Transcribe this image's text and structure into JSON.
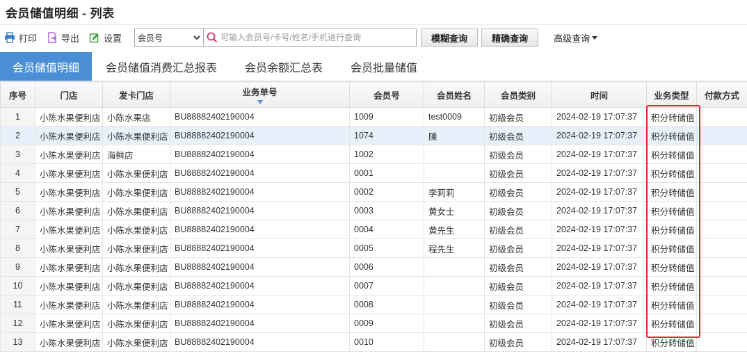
{
  "title": "会员储值明细 - 列表",
  "toolbar": {
    "print_label": "打印",
    "export_label": "导出",
    "settings_label": "设置",
    "search_field_value": "会员号",
    "search_placeholder": "可输入会员号/卡号/姓名/手机进行查询",
    "fuzzy_label": "模糊查询",
    "exact_label": "精确查询",
    "advanced_label": "高级查询"
  },
  "tabs": [
    {
      "label": "会员储值明细",
      "active": true
    },
    {
      "label": "会员储值消费汇总报表",
      "active": false
    },
    {
      "label": "会员余额汇总表",
      "active": false
    },
    {
      "label": "会员批量储值",
      "active": false
    }
  ],
  "table": {
    "headers": [
      "序号",
      "门店",
      "发卡门店",
      "业务单号",
      "会员号",
      "会员姓名",
      "会员类别",
      "时间",
      "业务类型",
      "付款方式"
    ],
    "rows": [
      [
        "1",
        "小陈水果便利店",
        "小陈水果店",
        "BU88882402190004",
        "1009",
        "test0009",
        "初级会员",
        "2024-02-19 17:07:37",
        "积分转储值",
        ""
      ],
      [
        "2",
        "小陈水果便利店",
        "小陈水果便利店",
        "BU88882402190004",
        "1074",
        "陳",
        "初级会员",
        "2024-02-19 17:07:37",
        "积分转储值",
        ""
      ],
      [
        "3",
        "小陈水果便利店",
        "海鲜店",
        "BU88882402190004",
        "1002",
        "",
        "初级会员",
        "2024-02-19 17:07:37",
        "积分转储值",
        ""
      ],
      [
        "4",
        "小陈水果便利店",
        "小陈水果便利店",
        "BU88882402190004",
        "0001",
        "",
        "初级会员",
        "2024-02-19 17:07:37",
        "积分转储值",
        ""
      ],
      [
        "5",
        "小陈水果便利店",
        "小陈水果便利店",
        "BU88882402190004",
        "0002",
        "李莉莉",
        "初级会员",
        "2024-02-19 17:07:37",
        "积分转储值",
        ""
      ],
      [
        "6",
        "小陈水果便利店",
        "小陈水果便利店",
        "BU88882402190004",
        "0003",
        "黄女士",
        "初级会员",
        "2024-02-19 17:07:37",
        "积分转储值",
        ""
      ],
      [
        "7",
        "小陈水果便利店",
        "小陈水果便利店",
        "BU88882402190004",
        "0004",
        "黄先生",
        "初级会员",
        "2024-02-19 17:07:37",
        "积分转储值",
        ""
      ],
      [
        "8",
        "小陈水果便利店",
        "小陈水果便利店",
        "BU88882402190004",
        "0005",
        "程先生",
        "初级会员",
        "2024-02-19 17:07:37",
        "积分转储值",
        ""
      ],
      [
        "9",
        "小陈水果便利店",
        "小陈水果便利店",
        "BU88882402190004",
        "0006",
        "",
        "初级会员",
        "2024-02-19 17:07:37",
        "积分转储值",
        ""
      ],
      [
        "10",
        "小陈水果便利店",
        "小陈水果便利店",
        "BU88882402190004",
        "0007",
        "",
        "初级会员",
        "2024-02-19 17:07:37",
        "积分转储值",
        ""
      ],
      [
        "11",
        "小陈水果便利店",
        "小陈水果便利店",
        "BU88882402190004",
        "0008",
        "",
        "初级会员",
        "2024-02-19 17:07:37",
        "积分转储值",
        ""
      ],
      [
        "12",
        "小陈水果便利店",
        "小陈水果便利店",
        "BU88882402190004",
        "0009",
        "",
        "初级会员",
        "2024-02-19 17:07:37",
        "积分转储值",
        ""
      ],
      [
        "13",
        "小陈水果便利店",
        "小陈水果便利店",
        "BU88882402190004",
        "0010",
        "",
        "初级会员",
        "2024-02-19 17:07:37",
        "积分转储值",
        ""
      ]
    ],
    "selected_row": 2,
    "sorted_column": "业务单号"
  },
  "colors": {
    "accent": "#4a8fd6",
    "highlight": "#e3262b",
    "search_icon": "#d6336c",
    "export_icon": "#b45fd6",
    "settings_icon": "#3a9a3a"
  },
  "icons": [
    "print-icon",
    "export-icon",
    "settings-icon",
    "search-icon",
    "chevron-down-icon",
    "sort-desc-icon"
  ]
}
